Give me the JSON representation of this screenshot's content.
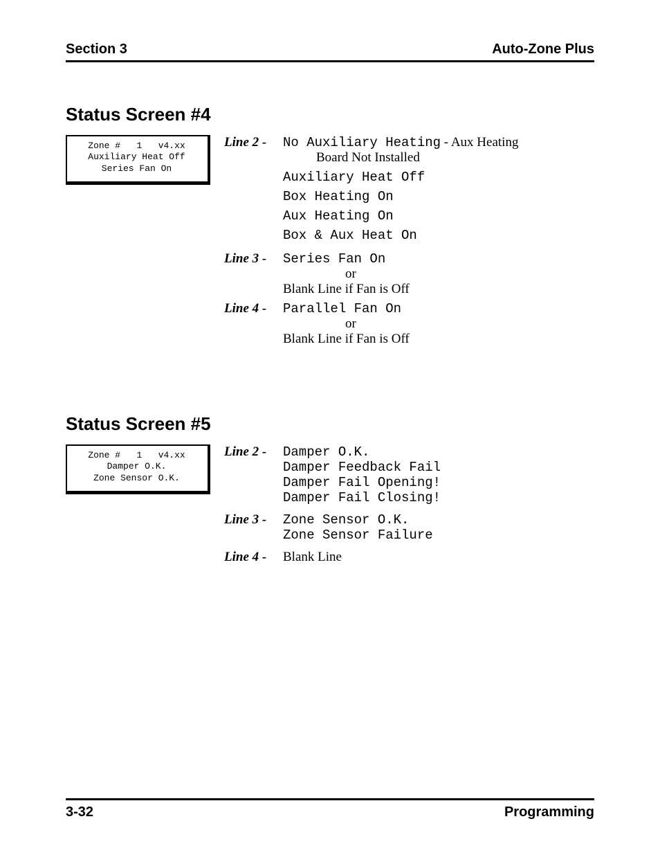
{
  "header": {
    "left": "Section 3",
    "right": "Auto-Zone Plus"
  },
  "status4": {
    "heading": "Status Screen #4",
    "lcd_l1": "Zone #   1   v4.xx",
    "lcd_l2": "Auxiliary Heat Off",
    "lcd_l3": "Series Fan On",
    "line2_label": "Line 2 -",
    "line2_item1_mono": "No Auxiliary Heating",
    "line2_item1_note": " - Aux Heating",
    "line2_item1_note2": "Board Not Installed",
    "line2_item2": "Auxiliary Heat Off",
    "line2_item3": "Box Heating On",
    "line2_item4": "Aux Heating On",
    "line2_item5": "Box & Aux Heat On",
    "line3_label": "Line 3 -",
    "line3_item1": "Series Fan On",
    "line3_or": "or",
    "line3_blank": "Blank Line if Fan is Off",
    "line4_label": "Line 4 -",
    "line4_item1": "Parallel Fan On",
    "line4_or": "or",
    "line4_blank": "Blank Line if Fan is Off"
  },
  "status5": {
    "heading": "Status Screen #5",
    "lcd_l1": "Zone #   1   v4.xx",
    "lcd_l2": "Damper O.K.",
    "lcd_l3": "Zone Sensor O.K.",
    "line2_label": "Line 2 -",
    "line2_item1": "Damper O.K.",
    "line2_item2": "Damper Feedback Fail",
    "line2_item3": "Damper Fail Opening!",
    "line2_item4": "Damper Fail Closing!",
    "line3_label": "Line 3 -",
    "line3_item1": "Zone Sensor O.K.",
    "line3_item2": "Zone Sensor Failure",
    "line4_label": "Line 4 -",
    "line4_blank": "Blank Line"
  },
  "footer": {
    "left": "3-32",
    "right": "Programming"
  }
}
